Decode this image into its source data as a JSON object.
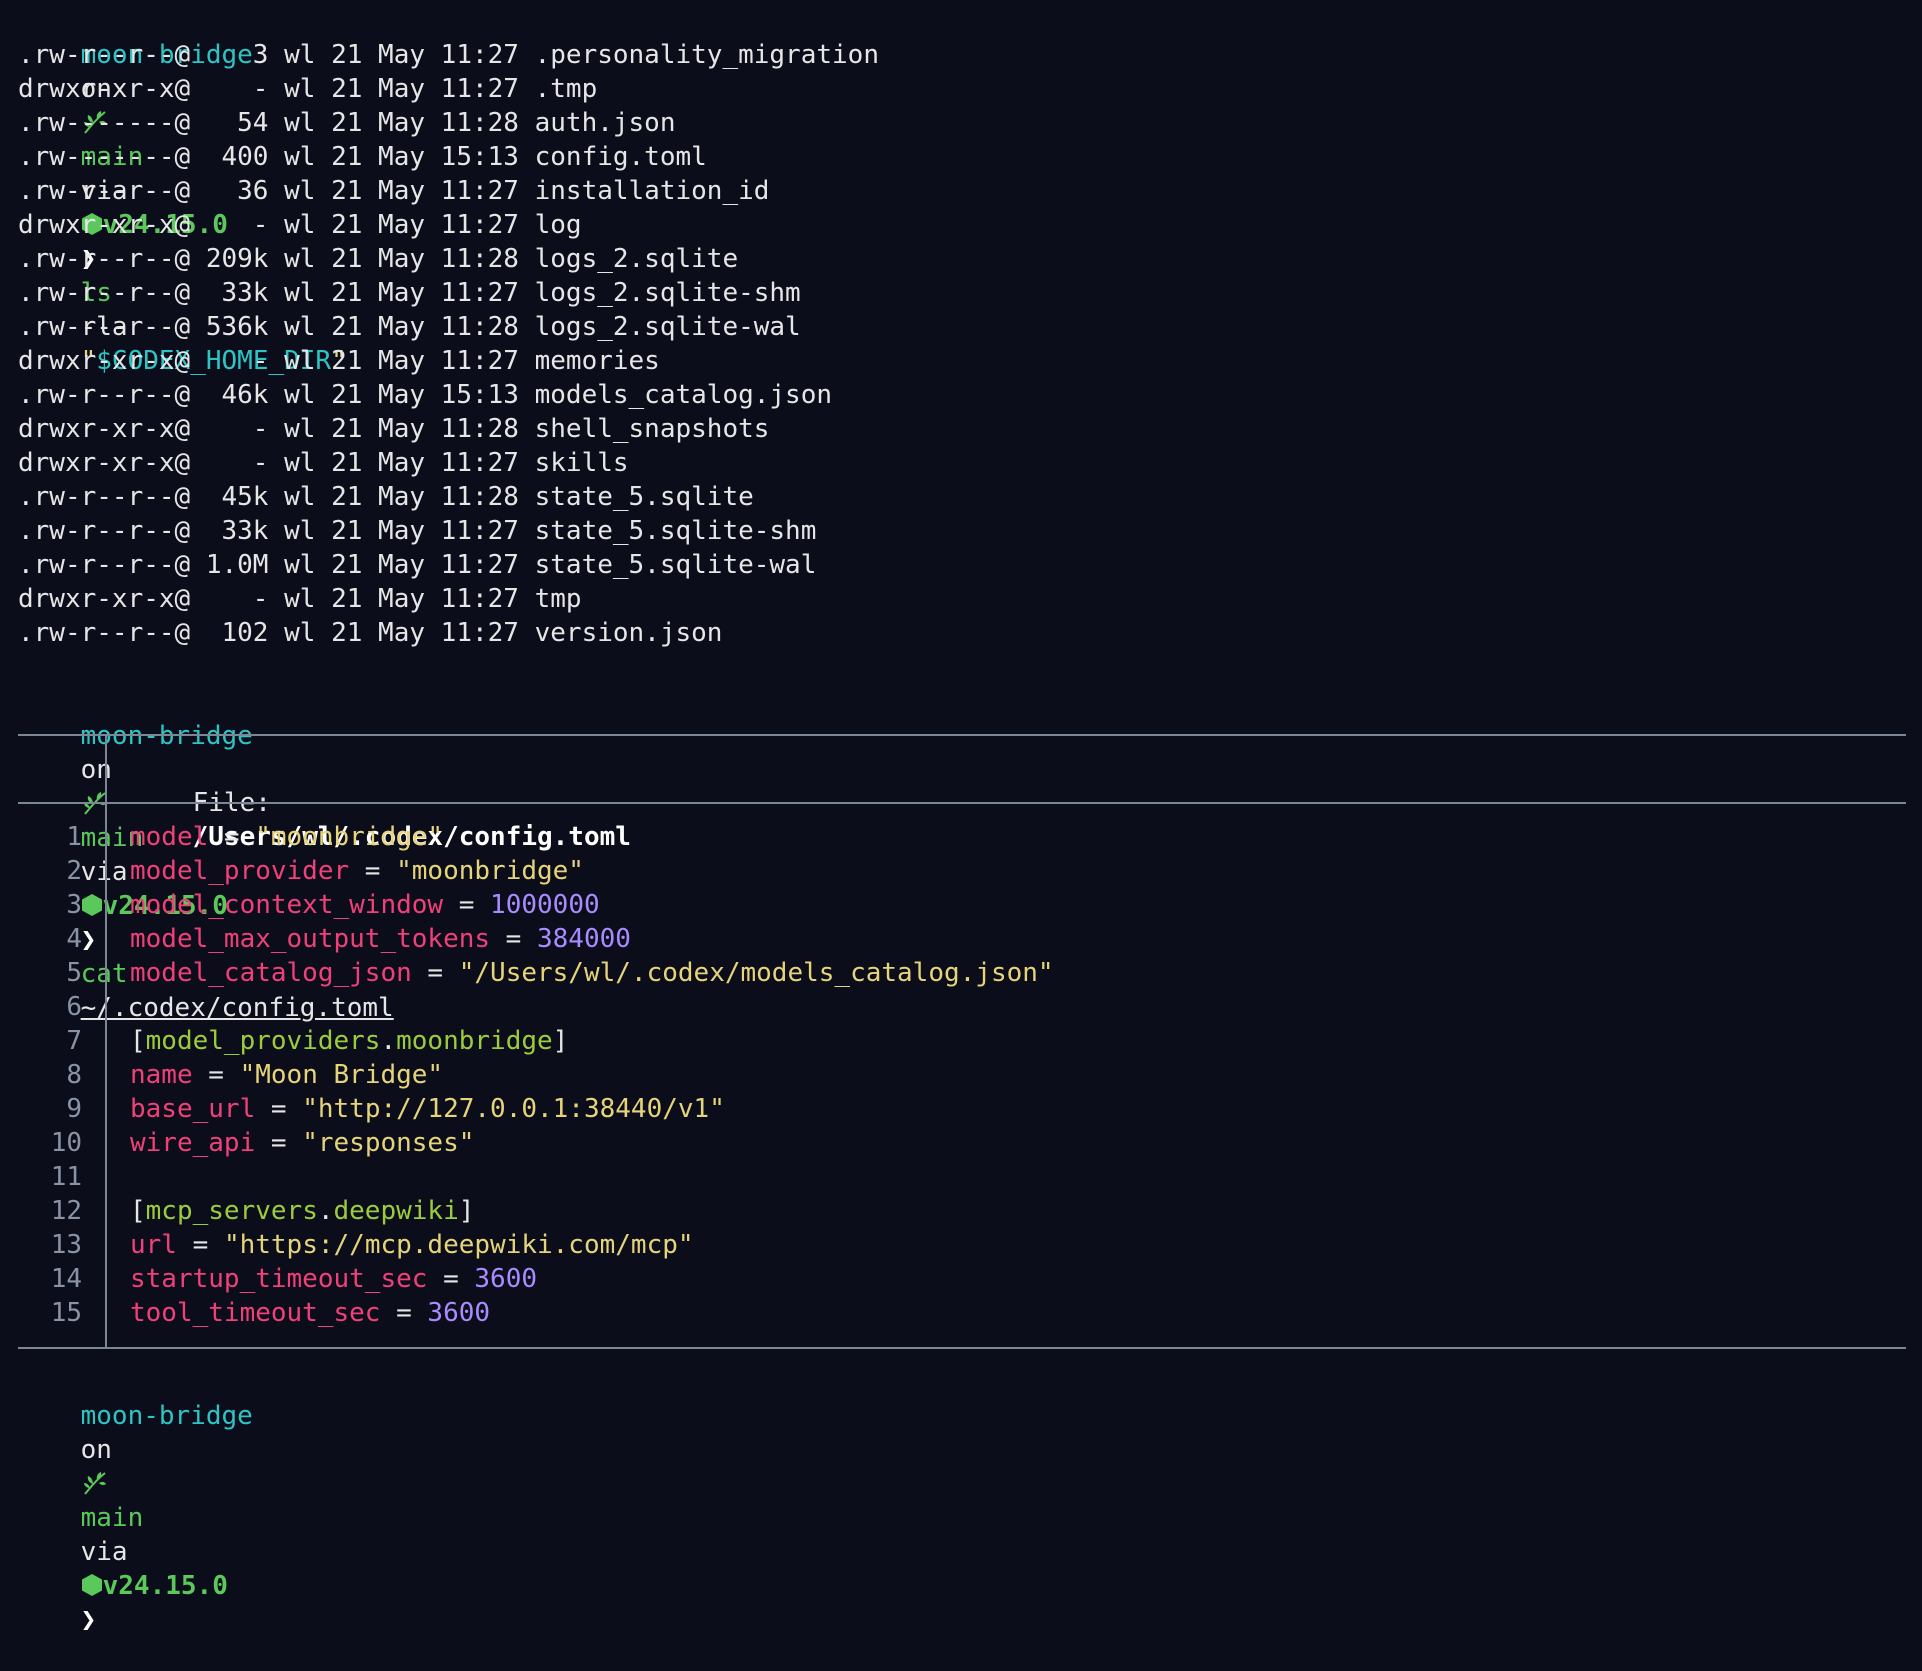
{
  "prompt": {
    "dir": "moon-bridge",
    "on": "on",
    "branch": "main",
    "via": "via",
    "node_version": "v24.15.0",
    "arrow": "❯"
  },
  "command1": {
    "cmd": "ls",
    "args": "-la",
    "quote_open": "\"",
    "var": "$CODEX_HOME_DIR",
    "quote_close": "\""
  },
  "listing": [
    {
      "perm": ".rw-r--r--@",
      "size": "3",
      "user": "wl",
      "day": "21",
      "month": "May",
      "time": "11:27",
      "name": ".personality_migration"
    },
    {
      "perm": "drwxr-xr-x@",
      "size": "-",
      "user": "wl",
      "day": "21",
      "month": "May",
      "time": "11:27",
      "name": ".tmp"
    },
    {
      "perm": ".rw-------@",
      "size": "54",
      "user": "wl",
      "day": "21",
      "month": "May",
      "time": "11:28",
      "name": "auth.json"
    },
    {
      "perm": ".rw-------@",
      "size": "400",
      "user": "wl",
      "day": "21",
      "month": "May",
      "time": "15:13",
      "name": "config.toml"
    },
    {
      "perm": ".rw-r--r--@",
      "size": "36",
      "user": "wl",
      "day": "21",
      "month": "May",
      "time": "11:27",
      "name": "installation_id"
    },
    {
      "perm": "drwxr-xr-x@",
      "size": "-",
      "user": "wl",
      "day": "21",
      "month": "May",
      "time": "11:27",
      "name": "log"
    },
    {
      "perm": ".rw-r--r--@",
      "size": "209k",
      "user": "wl",
      "day": "21",
      "month": "May",
      "time": "11:28",
      "name": "logs_2.sqlite"
    },
    {
      "perm": ".rw-r--r--@",
      "size": "33k",
      "user": "wl",
      "day": "21",
      "month": "May",
      "time": "11:27",
      "name": "logs_2.sqlite-shm"
    },
    {
      "perm": ".rw-r--r--@",
      "size": "536k",
      "user": "wl",
      "day": "21",
      "month": "May",
      "time": "11:28",
      "name": "logs_2.sqlite-wal"
    },
    {
      "perm": "drwxr-xr-x@",
      "size": "-",
      "user": "wl",
      "day": "21",
      "month": "May",
      "time": "11:27",
      "name": "memories"
    },
    {
      "perm": ".rw-r--r--@",
      "size": "46k",
      "user": "wl",
      "day": "21",
      "month": "May",
      "time": "15:13",
      "name": "models_catalog.json"
    },
    {
      "perm": "drwxr-xr-x@",
      "size": "-",
      "user": "wl",
      "day": "21",
      "month": "May",
      "time": "11:28",
      "name": "shell_snapshots"
    },
    {
      "perm": "drwxr-xr-x@",
      "size": "-",
      "user": "wl",
      "day": "21",
      "month": "May",
      "time": "11:27",
      "name": "skills"
    },
    {
      "perm": ".rw-r--r--@",
      "size": "45k",
      "user": "wl",
      "day": "21",
      "month": "May",
      "time": "11:28",
      "name": "state_5.sqlite"
    },
    {
      "perm": ".rw-r--r--@",
      "size": "33k",
      "user": "wl",
      "day": "21",
      "month": "May",
      "time": "11:27",
      "name": "state_5.sqlite-shm"
    },
    {
      "perm": ".rw-r--r--@",
      "size": "1.0M",
      "user": "wl",
      "day": "21",
      "month": "May",
      "time": "11:27",
      "name": "state_5.sqlite-wal"
    },
    {
      "perm": "drwxr-xr-x@",
      "size": "-",
      "user": "wl",
      "day": "21",
      "month": "May",
      "time": "11:27",
      "name": "tmp"
    },
    {
      "perm": ".rw-r--r--@",
      "size": "102",
      "user": "wl",
      "day": "21",
      "month": "May",
      "time": "11:27",
      "name": "version.json"
    }
  ],
  "command2": {
    "cmd": "cat",
    "path": "~/.codex/config.toml"
  },
  "file_view": {
    "label": "File:",
    "path": "/Users/wl/.codex/config.toml",
    "lines": [
      {
        "n": "1",
        "parts": [
          {
            "t": "model",
            "c": "pink"
          },
          {
            "t": " = ",
            "c": "white"
          },
          {
            "t": "\"moonbridge\"",
            "c": "yellow"
          }
        ]
      },
      {
        "n": "2",
        "parts": [
          {
            "t": "model_provider",
            "c": "pink"
          },
          {
            "t": " = ",
            "c": "white"
          },
          {
            "t": "\"moonbridge\"",
            "c": "yellow"
          }
        ]
      },
      {
        "n": "3",
        "parts": [
          {
            "t": "model_context_window",
            "c": "pink"
          },
          {
            "t": " = ",
            "c": "white"
          },
          {
            "t": "1000000",
            "c": "purple"
          }
        ]
      },
      {
        "n": "4",
        "parts": [
          {
            "t": "model_max_output_tokens",
            "c": "pink"
          },
          {
            "t": " = ",
            "c": "white"
          },
          {
            "t": "384000",
            "c": "purple"
          }
        ]
      },
      {
        "n": "5",
        "parts": [
          {
            "t": "model_catalog_json",
            "c": "pink"
          },
          {
            "t": " = ",
            "c": "white"
          },
          {
            "t": "\"/Users/wl/.codex/models_catalog.json\"",
            "c": "yellow"
          }
        ]
      },
      {
        "n": "6",
        "parts": []
      },
      {
        "n": "7",
        "parts": [
          {
            "t": "[",
            "c": "white"
          },
          {
            "t": "model_providers",
            "c": "lime"
          },
          {
            "t": ".",
            "c": "white"
          },
          {
            "t": "moonbridge",
            "c": "lime"
          },
          {
            "t": "]",
            "c": "white"
          }
        ]
      },
      {
        "n": "8",
        "parts": [
          {
            "t": "name",
            "c": "pink"
          },
          {
            "t": " = ",
            "c": "white"
          },
          {
            "t": "\"Moon Bridge\"",
            "c": "yellow"
          }
        ]
      },
      {
        "n": "9",
        "parts": [
          {
            "t": "base_url",
            "c": "pink"
          },
          {
            "t": " = ",
            "c": "white"
          },
          {
            "t": "\"http://127.0.0.1:38440/v1\"",
            "c": "yellow"
          }
        ]
      },
      {
        "n": "10",
        "parts": [
          {
            "t": "wire_api",
            "c": "pink"
          },
          {
            "t": " = ",
            "c": "white"
          },
          {
            "t": "\"responses\"",
            "c": "yellow"
          }
        ]
      },
      {
        "n": "11",
        "parts": []
      },
      {
        "n": "12",
        "parts": [
          {
            "t": "[",
            "c": "white"
          },
          {
            "t": "mcp_servers",
            "c": "lime"
          },
          {
            "t": ".",
            "c": "white"
          },
          {
            "t": "deepwiki",
            "c": "lime"
          },
          {
            "t": "]",
            "c": "white"
          }
        ]
      },
      {
        "n": "13",
        "parts": [
          {
            "t": "url",
            "c": "pink"
          },
          {
            "t": " = ",
            "c": "white"
          },
          {
            "t": "\"https://mcp.deepwiki.com/mcp\"",
            "c": "yellow"
          }
        ]
      },
      {
        "n": "14",
        "parts": [
          {
            "t": "startup_timeout_sec",
            "c": "pink"
          },
          {
            "t": " = ",
            "c": "white"
          },
          {
            "t": "3600",
            "c": "purple"
          }
        ]
      },
      {
        "n": "15",
        "parts": [
          {
            "t": "tool_timeout_sec",
            "c": "pink"
          },
          {
            "t": " = ",
            "c": "white"
          },
          {
            "t": "3600",
            "c": "purple"
          }
        ]
      }
    ]
  },
  "icons": {
    "branch": "leaf-icon",
    "node": "nodejs-hexagon-icon"
  },
  "colors": {
    "background": "#0c0d1a",
    "prompt_dir": "#2ec4c4",
    "prompt_branch": "#5ac85a",
    "key": "#f0407a",
    "string": "#e6d47a",
    "number": "#a98bff",
    "section": "#9ccc3c"
  }
}
